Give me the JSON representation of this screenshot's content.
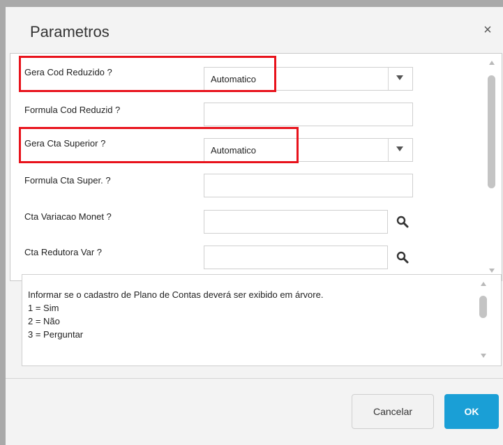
{
  "dialog": {
    "title": "Parametros",
    "close_label": "×"
  },
  "params": [
    {
      "label": "Gera Cod Reduzido ?",
      "type": "select",
      "value": "Automatico"
    },
    {
      "label": "Formula Cod Reduzid ?",
      "type": "text",
      "value": ""
    },
    {
      "label": "Gera Cta Superior ?",
      "type": "select",
      "value": "Automatico"
    },
    {
      "label": "Formula Cta Super. ?",
      "type": "text",
      "value": ""
    },
    {
      "label": "Cta Variacao Monet ?",
      "type": "lookup",
      "value": ""
    },
    {
      "label": "Cta Redutora Var ?",
      "type": "lookup",
      "value": ""
    }
  ],
  "help": {
    "lines": [
      "Informar se o cadastro de Plano de Contas deverá ser exibido em árvore.",
      "1 = Sim",
      "2 = Não",
      "3 = Perguntar"
    ]
  },
  "buttons": {
    "cancel": "Cancelar",
    "ok": "OK"
  },
  "colors": {
    "highlight": "#e8121b",
    "ok_button": "#1a9fd6"
  },
  "icons": {
    "lookup": "search-icon",
    "select": "chevron-down-icon"
  }
}
